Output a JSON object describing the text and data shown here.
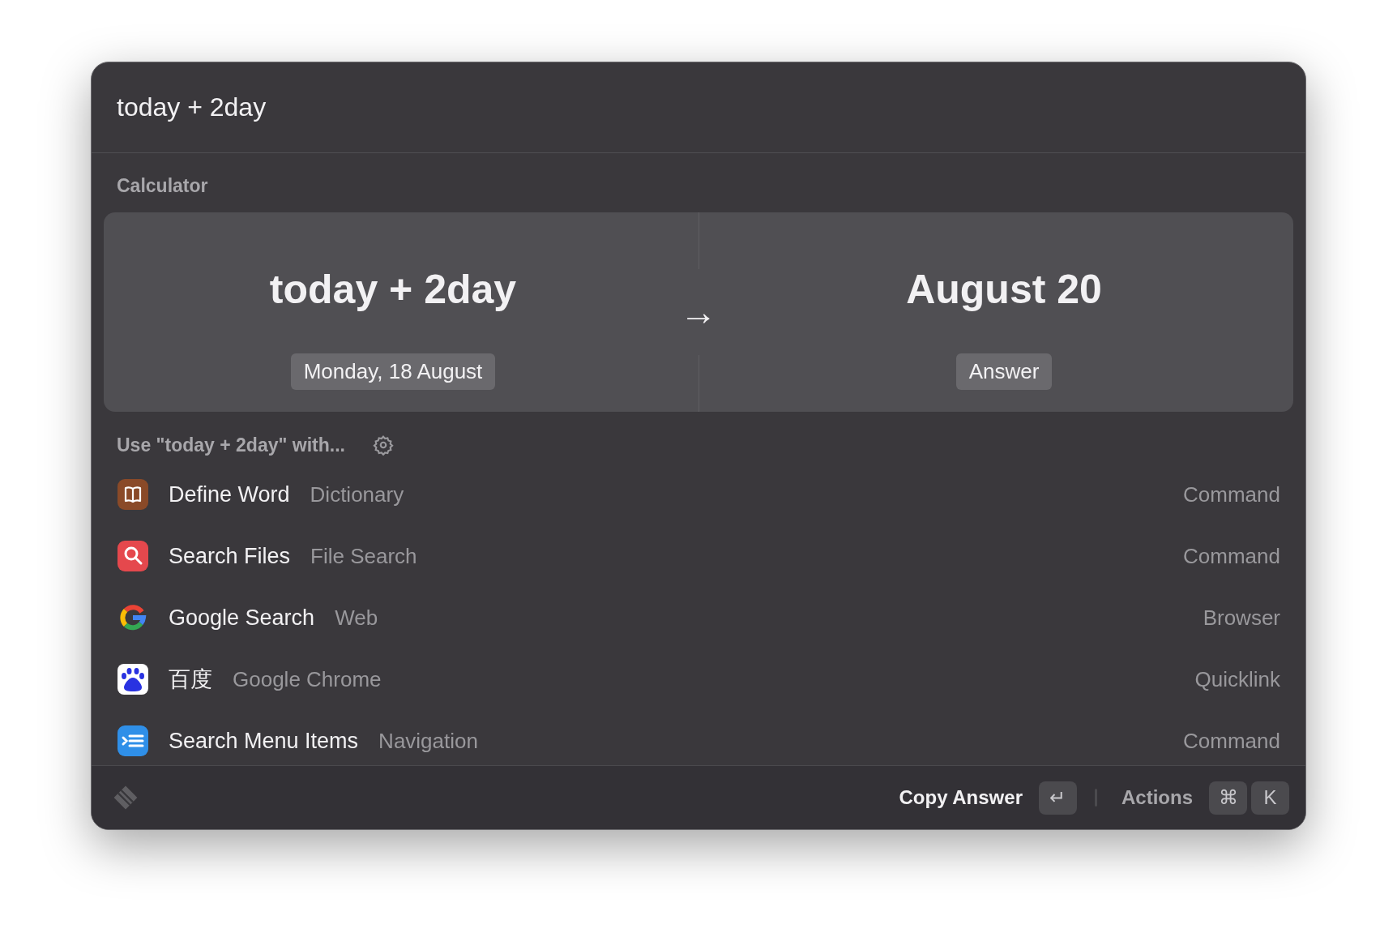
{
  "search": {
    "value": "today + 2day"
  },
  "calculator": {
    "heading": "Calculator",
    "expression": "today + 2day",
    "expression_hint": "Monday, 18 August",
    "arrow": "→",
    "result": "August 20",
    "result_hint": "Answer"
  },
  "suggestions": {
    "heading": "Use \"today + 2day\" with...",
    "items": [
      {
        "title": "Define Word",
        "subtitle": "Dictionary",
        "accessory": "Command"
      },
      {
        "title": "Search Files",
        "subtitle": "File Search",
        "accessory": "Command"
      },
      {
        "title": "Google Search",
        "subtitle": "Web",
        "accessory": "Browser"
      },
      {
        "title": "百度",
        "subtitle": "Google Chrome",
        "accessory": "Quicklink"
      },
      {
        "title": "Search Menu Items",
        "subtitle": "Navigation",
        "accessory": "Command"
      }
    ]
  },
  "footer": {
    "primary_action": "Copy Answer",
    "primary_keys": [
      "↵"
    ],
    "secondary_action": "Actions",
    "secondary_keys": [
      "⌘",
      "K"
    ]
  }
}
